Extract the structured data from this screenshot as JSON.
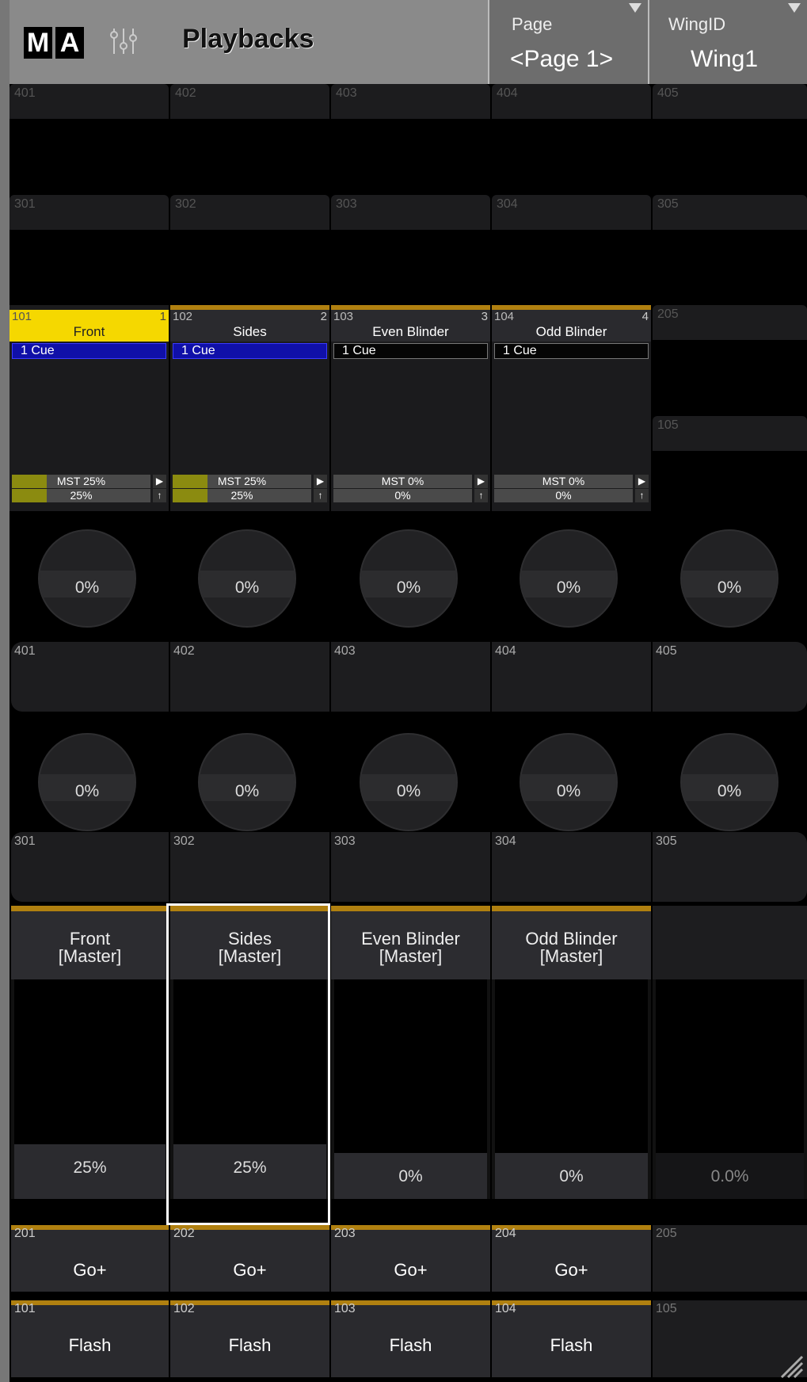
{
  "header": {
    "logo": [
      "M",
      "A"
    ],
    "title": "Playbacks",
    "page_label": "Page",
    "page_value": "<Page 1>",
    "wing_label": "WingID",
    "wing_value": "Wing1",
    "icon": "mixer-icon"
  },
  "grid_top": {
    "row400": [
      "401",
      "402",
      "403",
      "404",
      "405"
    ],
    "row300": [
      "301",
      "302",
      "303",
      "304",
      "305"
    ]
  },
  "executors": [
    {
      "number": "101",
      "page": "1",
      "name": "Front",
      "cue": "1 Cue",
      "mst": "MST 25%",
      "level": "25%",
      "active": true
    },
    {
      "number": "102",
      "page": "2",
      "name": "Sides",
      "cue": "1 Cue",
      "mst": "MST 25%",
      "level": "25%",
      "active": false
    },
    {
      "number": "103",
      "page": "3",
      "name": "Even Blinder",
      "cue": "1 Cue",
      "mst": "MST 0%",
      "level": "0%",
      "active": false
    },
    {
      "number": "104",
      "page": "4",
      "name": "Odd Blinder",
      "cue": "1 Cue",
      "mst": "MST 0%",
      "level": "0%",
      "active": false
    }
  ],
  "exec_fill": [
    0.25,
    0.25,
    0,
    0
  ],
  "empty_exec": {
    "a": "205",
    "b": "105"
  },
  "knobs_upper": [
    "0%",
    "0%",
    "0%",
    "0%",
    "0%"
  ],
  "knob_row_upper_labels": [
    "401",
    "402",
    "403",
    "404",
    "405"
  ],
  "knobs_lower": [
    "0%",
    "0%",
    "0%",
    "0%",
    "0%"
  ],
  "knob_row_lower_labels": [
    "301",
    "302",
    "303",
    "304",
    "305"
  ],
  "faders": [
    {
      "name": "Front",
      "sub": "[Master]",
      "value": "25%",
      "level": 0.25
    },
    {
      "name": "Sides",
      "sub": "[Master]",
      "value": "25%",
      "level": 0.25
    },
    {
      "name": "Even Blinder",
      "sub": "[Master]",
      "value": "0%",
      "level": 0
    },
    {
      "name": "Odd Blinder",
      "sub": "[Master]",
      "value": "0%",
      "level": 0
    },
    {
      "name": "",
      "sub": "",
      "value": "0.0%",
      "level": 0
    }
  ],
  "go_buttons": [
    {
      "num": "201",
      "label": "Go+"
    },
    {
      "num": "202",
      "label": "Go+"
    },
    {
      "num": "203",
      "label": "Go+"
    },
    {
      "num": "204",
      "label": "Go+"
    },
    {
      "num": "205",
      "label": ""
    }
  ],
  "flash_buttons": [
    {
      "num": "101",
      "label": "Flash"
    },
    {
      "num": "102",
      "label": "Flash"
    },
    {
      "num": "103",
      "label": "Flash"
    },
    {
      "num": "104",
      "label": "Flash"
    },
    {
      "num": "105",
      "label": ""
    }
  ],
  "colors": {
    "accent": "#b08010",
    "active": "#f5d800",
    "cue_bar": "#1010a8",
    "fill": "#8b8b10"
  }
}
